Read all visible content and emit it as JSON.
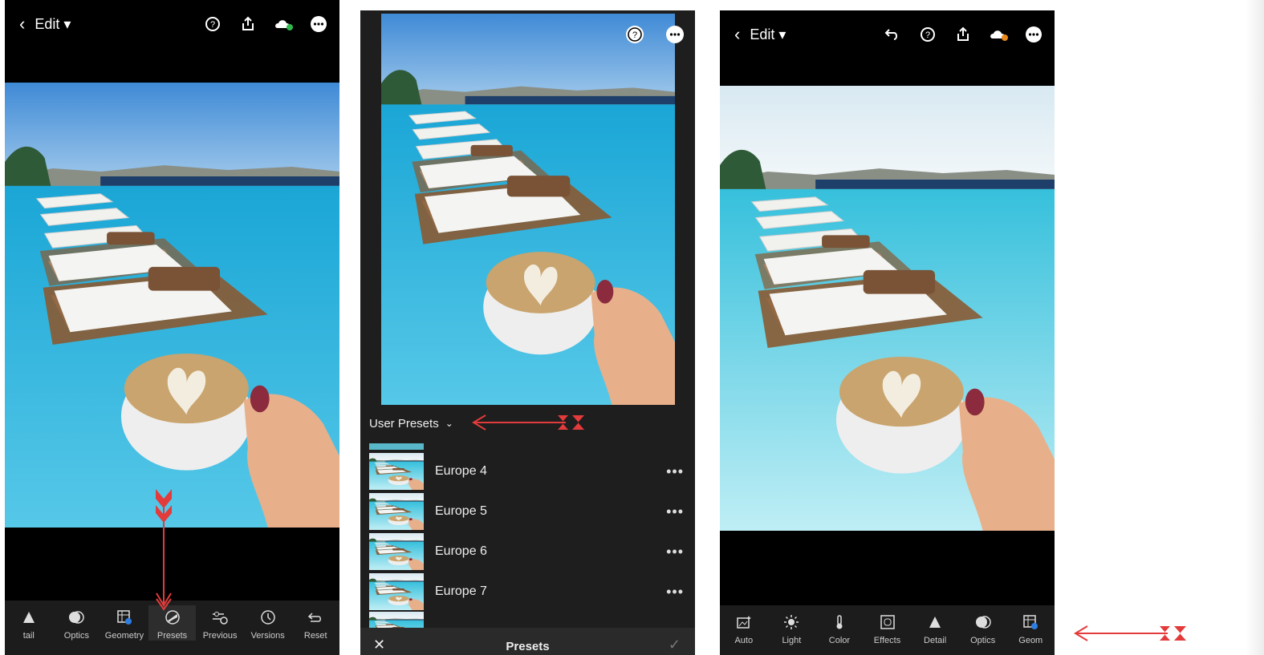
{
  "panel1": {
    "edit_label": "Edit",
    "tools": [
      {
        "icon": "detail-icon",
        "label": "tail"
      },
      {
        "icon": "optics-icon",
        "label": "Optics"
      },
      {
        "icon": "geometry-icon",
        "label": "Geometry"
      },
      {
        "icon": "presets-icon",
        "label": "Presets",
        "active": true
      },
      {
        "icon": "previous-icon",
        "label": "Previous"
      },
      {
        "icon": "versions-icon",
        "label": "Versions"
      },
      {
        "icon": "reset-icon",
        "label": "Reset"
      }
    ]
  },
  "panel2": {
    "group_label": "User Presets",
    "presets": [
      "Europe 4",
      "Europe 5",
      "Europe 6",
      "Europe 7"
    ],
    "more_label": "•••",
    "sheet_title": "Presets"
  },
  "panel3": {
    "edit_label": "Edit",
    "tools": [
      {
        "icon": "auto-icon",
        "label": "Auto"
      },
      {
        "icon": "light-icon",
        "label": "Light"
      },
      {
        "icon": "color-icon",
        "label": "Color"
      },
      {
        "icon": "effects-icon",
        "label": "Effects"
      },
      {
        "icon": "detail-icon",
        "label": "Detail"
      },
      {
        "icon": "optics-icon",
        "label": "Optics"
      },
      {
        "icon": "geometry-icon",
        "label": "Geom"
      }
    ]
  },
  "colors": {
    "annotation": "#e33b3b",
    "toolbar": "#1c1c1c",
    "sky": "#5c9fdc",
    "pool": "#29b5d8"
  }
}
